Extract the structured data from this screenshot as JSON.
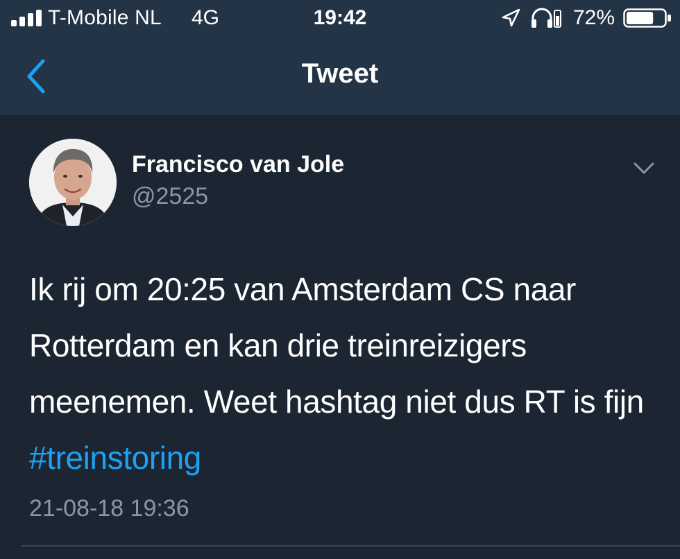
{
  "status_bar": {
    "carrier": "T-Mobile NL",
    "network": "4G",
    "time": "19:42",
    "battery_percent": "72%",
    "battery_level": 0.72,
    "signal_bars": 4,
    "icons": [
      "signal-icon",
      "location-arrow-icon",
      "headphones-icon",
      "battery-icon"
    ]
  },
  "nav": {
    "title": "Tweet",
    "back_icon": "chevron-left-icon"
  },
  "tweet": {
    "display_name": "Francisco van Jole",
    "handle": "@2525",
    "text": "Ik rij om 20:25 van Amsterdam CS naar Rotterdam en kan drie treinreizigers meenemen. Weet hashtag niet dus RT is fijn ",
    "hashtag": "#treinstoring",
    "timestamp": "21-08-18 19:36",
    "menu_icon": "chevron-down-icon"
  },
  "colors": {
    "background": "#1c2633",
    "header": "#243447",
    "accent": "#1da1f2",
    "secondary_text": "#8899a6",
    "text": "#ffffff"
  }
}
